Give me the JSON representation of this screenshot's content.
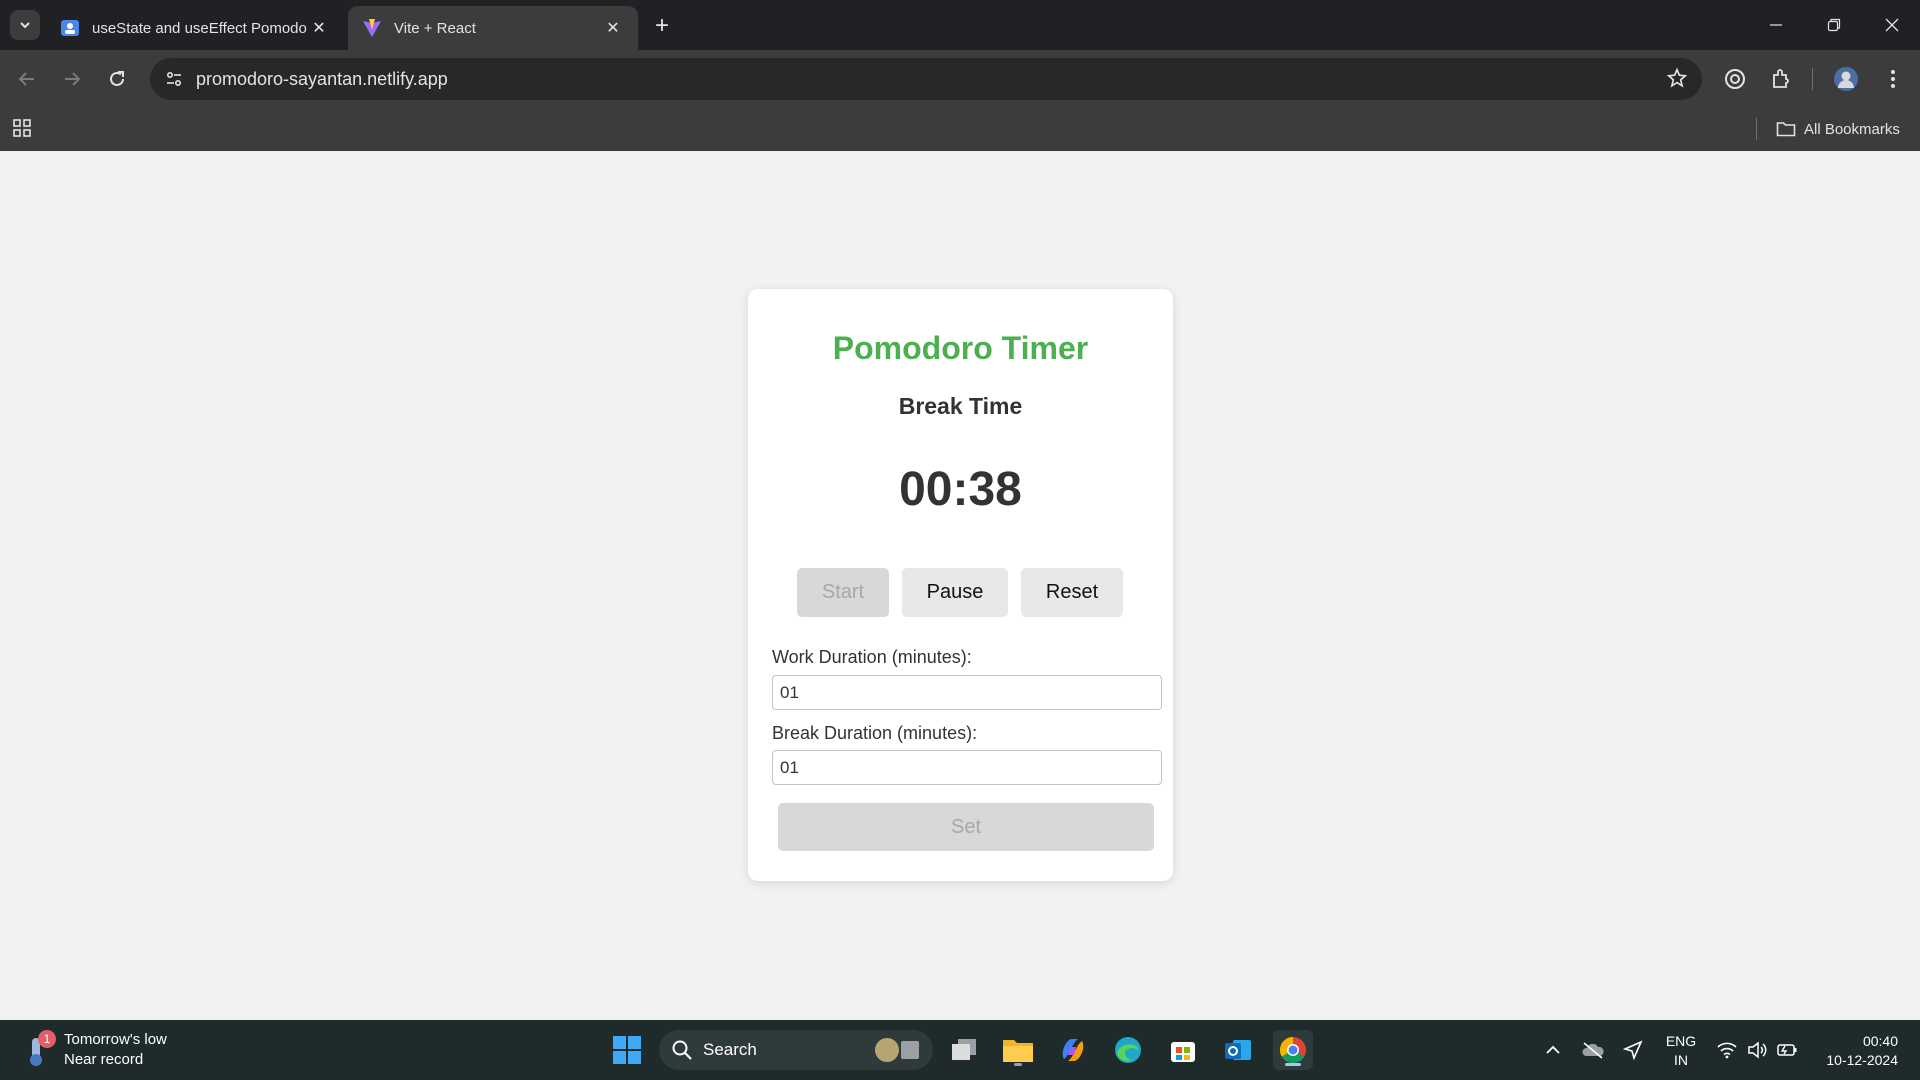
{
  "browser": {
    "tabs": [
      {
        "title": "useState and useEffect Pomodo",
        "active": false
      },
      {
        "title": "Vite + React",
        "active": true
      }
    ],
    "url": "promodoro-sayantan.netlify.app",
    "bookmarks": {
      "all_label": "All Bookmarks"
    }
  },
  "app": {
    "title": "Pomodoro Timer",
    "mode": "Break Time",
    "timer": "00:38",
    "buttons": {
      "start": "Start",
      "pause": "Pause",
      "reset": "Reset",
      "set": "Set"
    },
    "work_label": "Work Duration (minutes):",
    "work_value": "01",
    "break_label": "Break Duration (minutes):",
    "break_value": "01",
    "colors": {
      "title": "#4caf50",
      "text": "#333333",
      "button_bg": "#e8e8e8",
      "button_disabled_bg": "#d8d8d8"
    }
  },
  "taskbar": {
    "weather": {
      "line1": "Tomorrow's low",
      "line2": "Near record",
      "badge": "1"
    },
    "search_label": "Search",
    "language": {
      "line1": "ENG",
      "line2": "IN"
    },
    "clock": {
      "time": "00:40",
      "date": "10-12-2024"
    },
    "apps": [
      "start-icon",
      "task-view-icon",
      "file-explorer-icon",
      "copilot-icon",
      "edge-icon",
      "store-icon",
      "outlook-icon",
      "chrome-icon"
    ]
  }
}
